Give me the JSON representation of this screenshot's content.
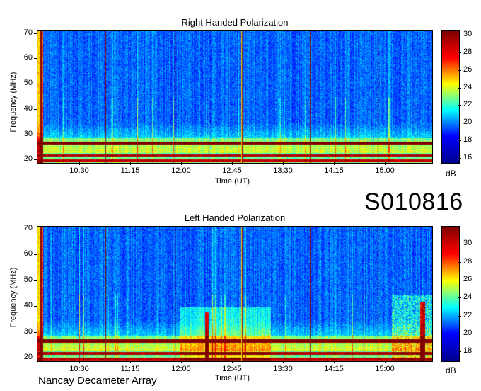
{
  "observation_id": "S010816",
  "instrument": "Nancay Decameter Array",
  "chart_data": [
    {
      "type": "heatmap",
      "title": "Right Handed Polarization",
      "xlabel": "Time (UT)",
      "ylabel": "Frequency (MHz)",
      "xticks": [
        "10:30",
        "11:15",
        "12:00",
        "12:45",
        "13:30",
        "14:15",
        "15:00"
      ],
      "yticks": [
        20,
        30,
        40,
        50,
        60,
        70
      ],
      "ylim": [
        19,
        71
      ],
      "colorbar": {
        "label": "dB",
        "ticks": [
          16,
          18,
          20,
          22,
          24,
          26,
          28,
          30
        ],
        "range": [
          15.5,
          30.5
        ]
      },
      "colormap": [
        "#00008f",
        "#0000ff",
        "#00ffff",
        "#ffff00",
        "#ff0000",
        "#800000"
      ]
    },
    {
      "type": "heatmap",
      "title": "Left Handed Polarization",
      "xlabel": "Time (UT)",
      "ylabel": "Frequency (MHz)",
      "xticks": [
        "10:30",
        "11:15",
        "12:00",
        "12:45",
        "13:30",
        "14:15",
        "15:00"
      ],
      "yticks": [
        20,
        30,
        40,
        50,
        60,
        70
      ],
      "ylim": [
        19,
        71
      ],
      "colorbar": {
        "label": "dB",
        "ticks": [
          18,
          20,
          22,
          24,
          26,
          28,
          30
        ],
        "range": [
          17,
          32
        ]
      },
      "colormap": [
        "#00008f",
        "#0000ff",
        "#00ffff",
        "#ffff00",
        "#ff0000",
        "#800000"
      ]
    }
  ]
}
